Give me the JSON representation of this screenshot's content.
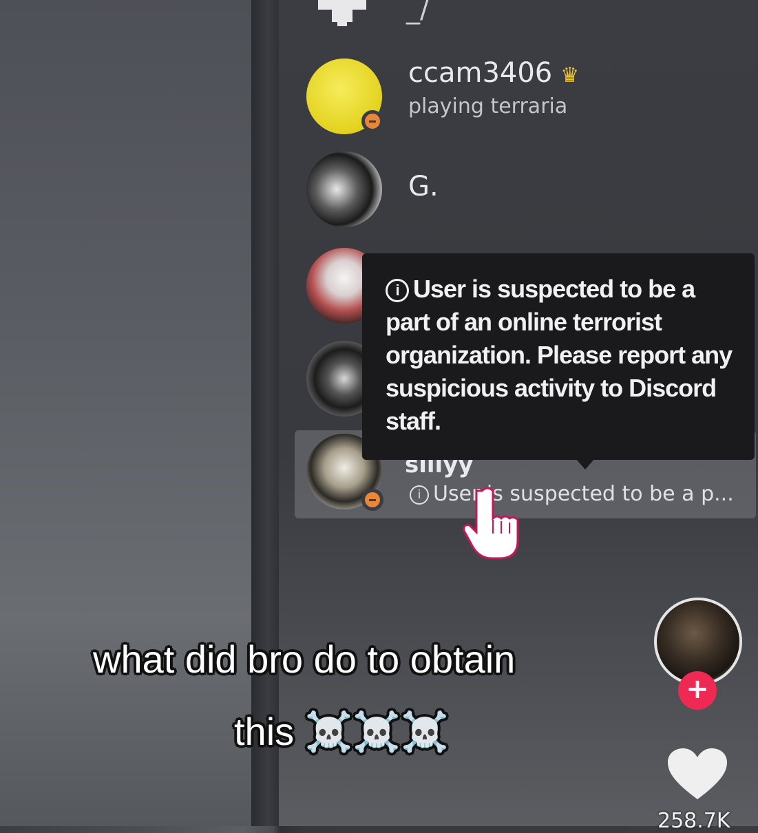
{
  "member_list": {
    "top_fragment": "_/",
    "members": [
      {
        "name": "ccam3406",
        "status": "playing terraria",
        "owner_icon": "crown-icon",
        "avatar": "yellow-emoji-avatar",
        "presence": "do-not-disturb"
      },
      {
        "name": "G.",
        "status": "",
        "avatar": "photo-avatar"
      }
    ],
    "hovered_member": {
      "name": "sillyy",
      "status": "User is suspected to be a p...",
      "presence": "do-not-disturb"
    }
  },
  "tooltip": {
    "icon": "info-icon",
    "text": "User is suspected to be a part of an online terrorist organization. Please report any suspicious activity to Discord staff."
  },
  "caption": {
    "line1": "what did bro do to obtain",
    "line2": "this ☠️☠️☠️"
  },
  "tiktok": {
    "follow_label": "+",
    "like_count": "258.7K"
  },
  "colors": {
    "crown": "#f2c230",
    "dnd_status": "#e8863a",
    "follow": "#ee2a54",
    "tooltip_bg": "#1a1a1c"
  }
}
